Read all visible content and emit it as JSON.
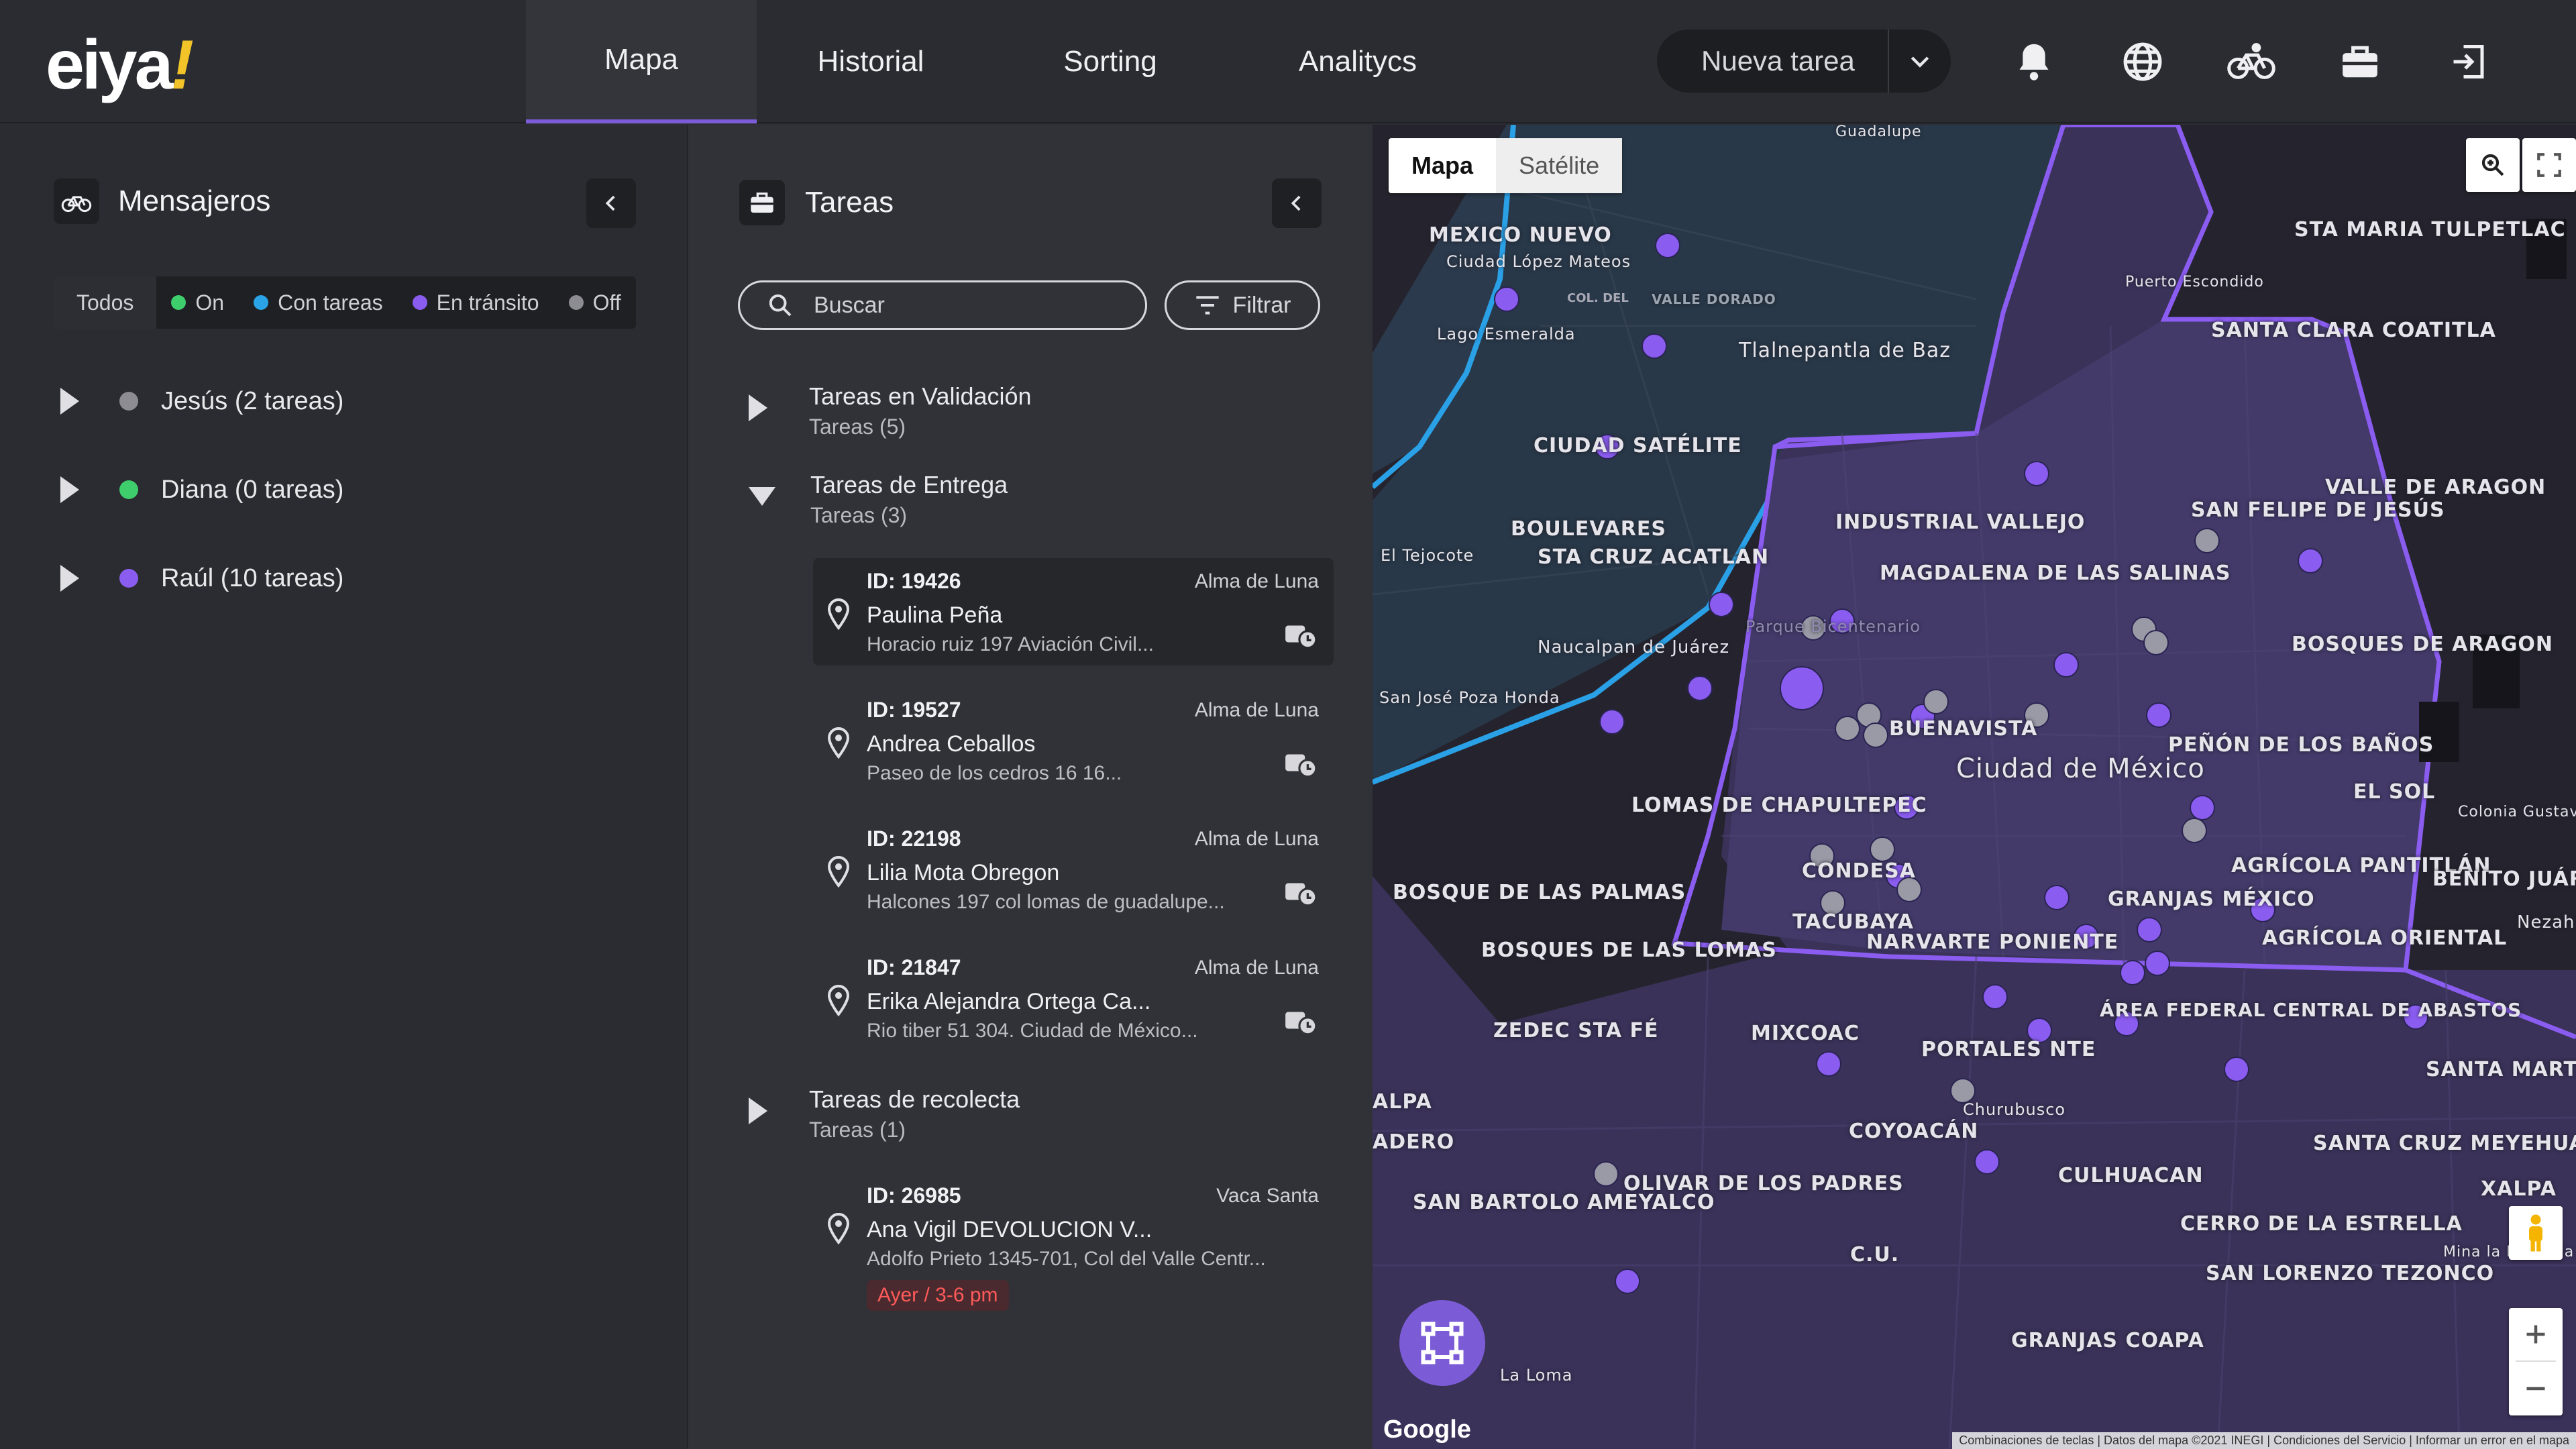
{
  "header": {
    "logo": "eiya",
    "logo_mark": "!",
    "tabs": [
      {
        "label": "Mapa",
        "active": true
      },
      {
        "label": "Historial"
      },
      {
        "label": "Sorting"
      },
      {
        "label": "Analitycs"
      }
    ],
    "new_task_label": "Nueva tarea",
    "icons": [
      "bell-icon",
      "globe-icon",
      "bicycle-icon",
      "briefcase-icon",
      "logout-icon"
    ]
  },
  "couriers_panel": {
    "title": "Mensajeros",
    "filters": [
      {
        "label": "Todos"
      },
      {
        "label": "On",
        "color": "#3ecf6c"
      },
      {
        "label": "Con tareas",
        "color": "#2aa4e6"
      },
      {
        "label": "En tránsito",
        "color": "#8a5cf0"
      },
      {
        "label": "Off",
        "color": "#8c8c92"
      }
    ],
    "couriers": [
      {
        "label": "Jesús (2 tareas)",
        "color": "#8c8c92"
      },
      {
        "label": "Diana (0 tareas)",
        "color": "#3ecf6c"
      },
      {
        "label": "Raúl (10 tareas)",
        "color": "#8a5cf0"
      }
    ]
  },
  "tasks_panel": {
    "title": "Tareas",
    "search_placeholder": "Buscar",
    "filter_label": "Filtrar",
    "groups": [
      {
        "title": "Tareas en Validación",
        "subtitle": "Tareas (5)"
      },
      {
        "title": "Tareas de Entrega",
        "subtitle": "Tareas (3)"
      },
      {
        "title": "Tareas de recolecta",
        "subtitle": "Tareas (1)"
      }
    ],
    "delivery_tasks": [
      {
        "id": "ID: 19426",
        "store": "Alma de Luna",
        "name": "Paulina Peña",
        "address": "Horacio ruiz 197 Aviación Civil..."
      },
      {
        "id": "ID: 19527",
        "store": "Alma de Luna",
        "name": "Andrea Ceballos",
        "address": "Paseo de los cedros 16 16..."
      },
      {
        "id": "ID: 22198",
        "store": "Alma de Luna",
        "name": "Lilia Mota Obregon",
        "address": "Halcones 197 col lomas de guadalupe..."
      },
      {
        "id": "ID: 21847",
        "store": "Alma de Luna",
        "name": "Erika Alejandra Ortega Ca...",
        "address": "Rio tiber 51 304. Ciudad de México..."
      }
    ],
    "pickup_tasks": [
      {
        "id": "ID: 26985",
        "store": "Vaca Santa",
        "name": "Ana Vigil DEVOLUCION V...",
        "address": "Adolfo Prieto 1345-701, Col del Valle Centr...",
        "badge": "Ayer / 3-6 pm"
      }
    ]
  },
  "map": {
    "toggle": {
      "map": "Mapa",
      "satellite": "Satélite"
    },
    "google": "Google",
    "attribution": "Combinaciones de teclas | Datos del mapa ©2021 INEGI | Condiciones del Servicio | Informar un error en el mapa",
    "labels": [
      "MEXICO NUEVO",
      "Ciudad López Mateos",
      "VALLE DORADO",
      "Tlalnepantla de Baz",
      "STA MARIA TULPETLAC",
      "SANTA CLARA COATITLA",
      "CIUDAD SATÉLITE",
      "VALLE DE ARAGON",
      "BOULEVARES",
      "STA CRUZ ACATLAN",
      "INDUSTRIAL VALLEJO",
      "MAGDALENA DE LAS SALINAS",
      "SAN FELIPE DE JESÚS",
      "El Tejocote",
      "Naucalpan de Juárez",
      "San José Poza Honda",
      "BUENAVISTA",
      "Ciudad de México",
      "PEÑÓN DE LOS BAÑOS",
      "EL SOL",
      "LOMAS DE CHAPULTEPEC",
      "CONDESA",
      "BOSQUE DE LAS PALMAS",
      "BOSQUES DE LAS LOMAS",
      "TACUBAYA",
      "NARVARTE PONIENTE",
      "GRANJAS MÉXICO",
      "AGRÍCOLA PANTITLÁN",
      "AGRÍCOLA ORIENTAL",
      "BENITO JUÁREZ",
      "ZEDEC STA FÉ",
      "MIXCOAC",
      "PORTALES NTE",
      "ÁREA FEDERAL CENTRAL DE ABASTOS",
      "SANTA MARTHA ACATITLA",
      "COYOACÁN",
      "Churubusco",
      "OLIVAR DE LOS PADRES",
      "SAN BARTOLO AMEYALCO",
      "CULHUACAN",
      "SANTA CRUZ MEYEHUALCO",
      "XALPA",
      "C.U.",
      "CERRO DE LA ESTRELLA",
      "SAN LORENZO TEZONCO",
      "GRANJAS COAPA",
      "La Loma",
      "Guadalupe",
      "Lago Esmeralda",
      "Parque Bicentenario",
      "Puerto Escondido",
      "BOSQUES DE ARAGON",
      "Colonia Gustavo Baz Prada",
      "Mina la Estancia",
      "ALPA",
      "ADERO",
      "Nezah"
    ]
  }
}
